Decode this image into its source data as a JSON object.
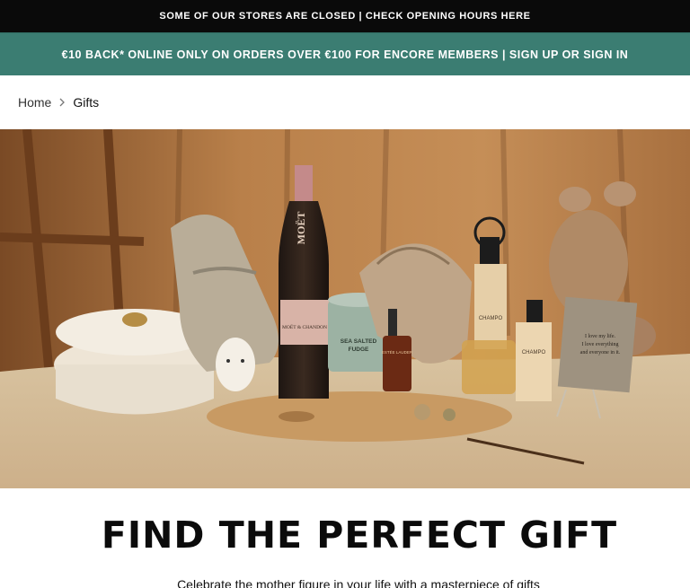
{
  "announcement": {
    "stores_text": "SOME OF OUR STORES ARE CLOSED | CHECK OPENING HOURS HERE",
    "promo_text": "€10 BACK* ONLINE ONLY ON ORDERS OVER €100 FOR ENCORE MEMBERS | SIGN UP OR SIGN IN"
  },
  "breadcrumb": {
    "home": "Home",
    "current": "Gifts"
  },
  "hero": {
    "champagne_brand": "MOËT",
    "champagne_label": "MOËT & CHANDON",
    "tin_label_1": "SEA SALTED",
    "tin_label_2": "FUDGE",
    "serum_label": "ESTÉE LAUDER",
    "bottle_label": "CHAMPO",
    "card_text_1": "I love my life.",
    "card_text_2": "I love everything",
    "card_text_3": "and everyone in it."
  },
  "main": {
    "headline": "FIND THE PERFECT GIFT",
    "subline": "Celebrate the mother figure in your life with a masterpiece of gifts"
  },
  "colors": {
    "topbar": "#0a0a0a",
    "promobar": "#3b7d72"
  }
}
